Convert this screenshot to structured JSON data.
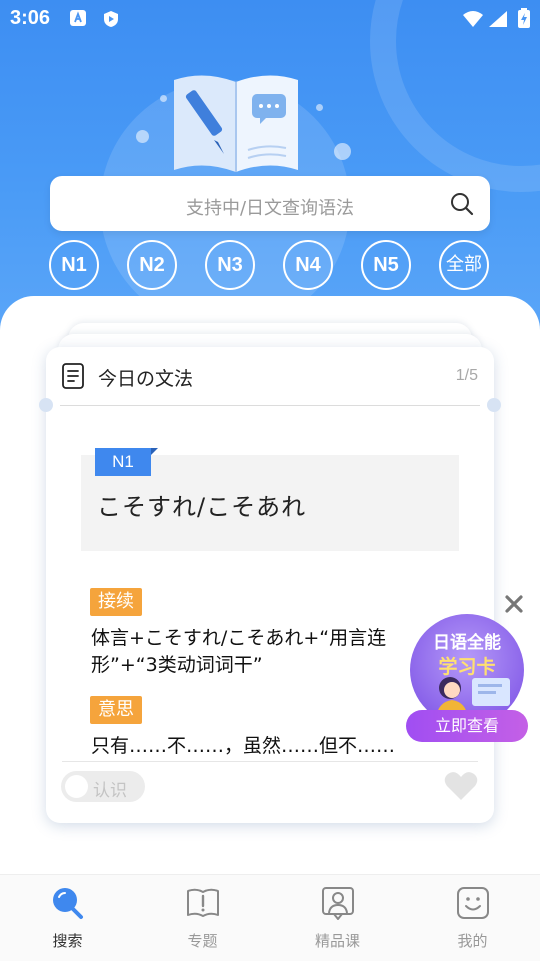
{
  "status_bar": {
    "time": "3:06"
  },
  "search": {
    "placeholder": "支持中/日文查询语法"
  },
  "levels": [
    "N1",
    "N2",
    "N3",
    "N4",
    "N5",
    "全部"
  ],
  "card": {
    "title": "今日の文法",
    "page": "1/5",
    "level_tag": "N1",
    "grammar": "こそすれ/こそあれ",
    "connection_label": "接续",
    "connection_text_line1": "体言+こそすれ/こそあれ+“用言连",
    "connection_text_line2": "形”+“3类动词词干”",
    "meaning_label": "意思",
    "meaning_text": "只有……不……，虽然……但不……",
    "toggle_label": "认识"
  },
  "promo": {
    "title": "日语全能",
    "subtitle": "学习卡",
    "button": "立即查看"
  },
  "tabs": [
    {
      "label": "搜索",
      "icon": "search-icon",
      "active": true
    },
    {
      "label": "专题",
      "icon": "book-icon",
      "active": false
    },
    {
      "label": "精品课",
      "icon": "teacher-icon",
      "active": false
    },
    {
      "label": "我的",
      "icon": "smiley-icon",
      "active": false
    }
  ],
  "colors": {
    "primary": "#3d8ef2",
    "accent_orange": "#f5a43c",
    "promo_purple": "#8a63ea"
  }
}
